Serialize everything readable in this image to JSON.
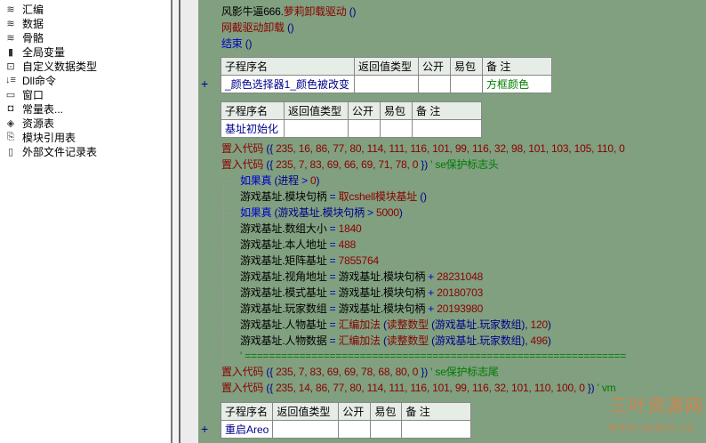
{
  "tree": [
    {
      "label": "汇编",
      "icon": "book-stack-icon"
    },
    {
      "label": "数据",
      "icon": "book-stack-icon"
    },
    {
      "label": "骨骼",
      "icon": "book-stack-icon"
    },
    {
      "label": "全局变量",
      "icon": "global-variable-icon"
    },
    {
      "label": "自定义数据类型",
      "icon": "data-type-icon"
    },
    {
      "label": "Dll命令",
      "icon": "dll-command-icon"
    },
    {
      "label": "窗口",
      "icon": "window-icon"
    },
    {
      "label": "常量表...",
      "icon": "constant-table-icon"
    },
    {
      "label": "资源表",
      "icon": "resource-table-icon"
    },
    {
      "label": "模块引用表",
      "icon": "module-reference-icon"
    },
    {
      "label": "外部文件记录表",
      "icon": "external-file-icon"
    }
  ],
  "code_top": [
    [
      [
        "风影牛逼666.",
        ""
      ],
      [
        "萝莉卸载驱动",
        "k"
      ],
      [
        " ()",
        "p"
      ]
    ],
    [
      [
        "网截驱动卸载",
        "k"
      ],
      [
        " ()",
        "p"
      ]
    ],
    [
      [
        "结束",
        "b"
      ],
      [
        " ()",
        "p"
      ]
    ]
  ],
  "table_headers": [
    "子程序名",
    "返回值类型",
    "公开",
    "易包",
    "备 注"
  ],
  "sub1": {
    "name": "_颜色选择器1_颜色被改变",
    "remark": "方框颜色"
  },
  "sub2": {
    "name": "基址初始化",
    "remark": ""
  },
  "sub3": {
    "name": "重启Areo",
    "remark": ""
  },
  "code_main": [
    [
      [
        "置入代码",
        "k"
      ],
      [
        " ({ ",
        "p"
      ],
      [
        "235, 16, 86, 77, 80, 114, 111, 116, 101, 99, 116, 32, 98, 101, 103, 105, 110, 0",
        "n"
      ]
    ],
    [
      [
        "置入代码",
        "k"
      ],
      [
        " ({ ",
        "p"
      ],
      [
        "235, 7, 83, 69, 66, 69, 71, 78, 0",
        "n"
      ],
      [
        " })",
        "p"
      ],
      [
        "  ' se保护标志头",
        "c"
      ]
    ],
    [
      [
        "如果真",
        "b"
      ],
      [
        " (进程 ",
        "p"
      ],
      [
        "> ",
        "b"
      ],
      [
        "0",
        "n"
      ],
      [
        ")",
        "p"
      ]
    ],
    [
      [
        "游戏基址.模块句柄 ",
        ""
      ],
      [
        "= ",
        "b"
      ],
      [
        "取cshell模块基址",
        "k"
      ],
      [
        " ()",
        "p"
      ]
    ],
    [
      [
        "如果真",
        "b"
      ],
      [
        " (游戏基址.模块句柄 ",
        "p"
      ],
      [
        "> ",
        "b"
      ],
      [
        "5000",
        "n"
      ],
      [
        ")",
        "p"
      ]
    ],
    [
      [
        "游戏基址.数组大小 ",
        ""
      ],
      [
        "= ",
        "b"
      ],
      [
        "1840",
        "n"
      ]
    ],
    [
      [
        "游戏基址.本人地址 ",
        ""
      ],
      [
        "= ",
        "b"
      ],
      [
        "488",
        "n"
      ]
    ],
    [
      [
        "游戏基址.矩阵基址 ",
        ""
      ],
      [
        "= ",
        "b"
      ],
      [
        "7855764",
        "n"
      ]
    ],
    [
      [
        "游戏基址.视角地址 ",
        ""
      ],
      [
        "= ",
        "b"
      ],
      [
        "游戏基址.模块句柄 ",
        ""
      ],
      [
        "+ ",
        "b"
      ],
      [
        "28231048",
        "n"
      ]
    ],
    [
      [
        "游戏基址.模式基址 ",
        ""
      ],
      [
        "= ",
        "b"
      ],
      [
        "游戏基址.模块句柄 ",
        ""
      ],
      [
        "+ ",
        "b"
      ],
      [
        "20180703",
        "n"
      ]
    ],
    [
      [
        "游戏基址.玩家数组 ",
        ""
      ],
      [
        "= ",
        "b"
      ],
      [
        "游戏基址.模块句柄 ",
        ""
      ],
      [
        "+ ",
        "b"
      ],
      [
        "20193980",
        "n"
      ]
    ],
    [
      [
        "游戏基址.人物基址 ",
        ""
      ],
      [
        "= ",
        "b"
      ],
      [
        "汇编加法",
        "k"
      ],
      [
        " (",
        "p"
      ],
      [
        "读整数型",
        "k"
      ],
      [
        " (游戏基址.玩家数组), ",
        "p"
      ],
      [
        "120",
        "n"
      ],
      [
        ")",
        "p"
      ]
    ],
    [
      [
        "游戏基址.人物数据 ",
        ""
      ],
      [
        "= ",
        "b"
      ],
      [
        "汇编加法",
        "k"
      ],
      [
        " (",
        "p"
      ],
      [
        "读整数型",
        "k"
      ],
      [
        " (游戏基址.玩家数组), ",
        "p"
      ],
      [
        "496",
        "n"
      ],
      [
        ")",
        "p"
      ]
    ],
    [
      [
        "' ===============================================================",
        "c"
      ]
    ],
    [
      [
        "置入代码",
        "k"
      ],
      [
        " ({ ",
        "p"
      ],
      [
        "235, 7, 83, 69, 69, 78, 68, 80, 0",
        "n"
      ],
      [
        " })",
        "p"
      ],
      [
        "  ' se保护标志尾",
        "c"
      ]
    ],
    [
      [
        "置入代码",
        "k"
      ],
      [
        " ({ ",
        "p"
      ],
      [
        "235, 14, 86, 77, 80, 114, 111, 116, 101, 99, 116, 32, 101, 110, 100, 0",
        "n"
      ],
      [
        " })",
        "p"
      ],
      [
        "  ' vm",
        "c"
      ]
    ]
  ],
  "watermark": {
    "title": "三叶资源网",
    "url": "www.sanye.cx"
  }
}
